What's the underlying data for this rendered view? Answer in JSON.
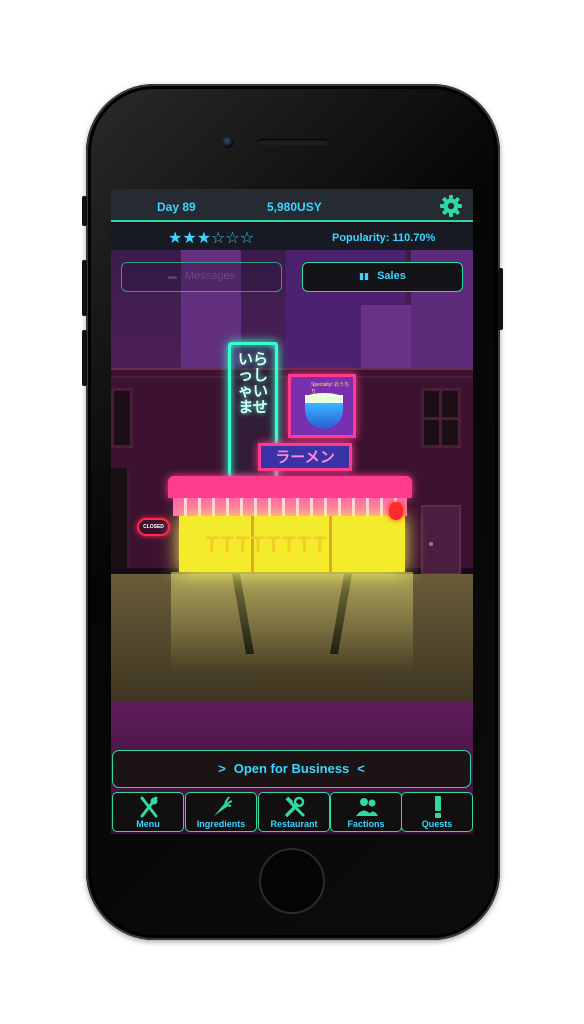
{
  "header": {
    "day": "Day 89",
    "money": "5,980USY",
    "settings_icon": "gear-icon"
  },
  "status": {
    "rating_stars_filled": 3,
    "rating_stars_total": 6,
    "stars_text_on": "★★★",
    "stars_text_off": "☆☆☆",
    "popularity": "Popularity: 110.70%"
  },
  "actions": {
    "messages_label": "Messages",
    "sales_label": "Sales"
  },
  "scene": {
    "vertical_sign": "いらっしゃいませ",
    "poster_text": "Specialty! おうちり",
    "ramen_sign": "ラーメン",
    "shop_pattern": "TTTTTTTT",
    "closed_sign": "CLOSED"
  },
  "open_button": {
    "label": "Open for Business",
    "chev_left": ">",
    "chev_right": "<"
  },
  "tabs": [
    {
      "label": "Menu",
      "icon": "fork-knife-icon"
    },
    {
      "label": "Ingredients",
      "icon": "carrot-icon"
    },
    {
      "label": "Restaurant",
      "icon": "tools-icon"
    },
    {
      "label": "Factions",
      "icon": "people-icon"
    },
    {
      "label": "Quests",
      "icon": "exclamation-icon"
    }
  ],
  "colors": {
    "accent_cyan": "#3ad6ff",
    "border_green": "#2fd9a0",
    "neon_pink": "#ff3b8e",
    "shop_yellow": "#f4ec2a"
  }
}
